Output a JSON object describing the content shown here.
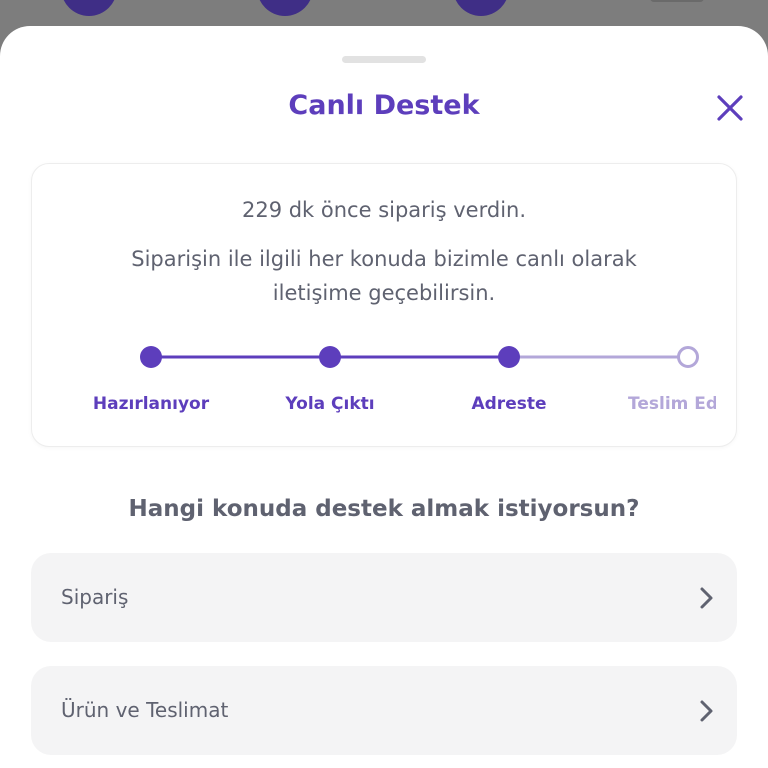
{
  "sheet": {
    "title": "Canlı Destek"
  },
  "order_status": {
    "ordered_text": "229 dk önce sipariş verdin.",
    "info_text": "Siparişin ile ilgili her konuda bizimle canlı olarak iletişime geçebilirsin.",
    "steps": [
      {
        "label": "Hazırlanıyor",
        "completed": true
      },
      {
        "label": "Yola Çıktı",
        "completed": true
      },
      {
        "label": "Adreste",
        "completed": true
      },
      {
        "label": "Teslim Edildi",
        "completed": false
      }
    ]
  },
  "support": {
    "question": "Hangi konuda destek almak istiyorsun?",
    "options": [
      {
        "label": "Sipariş"
      },
      {
        "label": "Ürün ve Teslimat"
      }
    ]
  },
  "colors": {
    "brand": "#5d3ebc",
    "pending": "#b3a7d9",
    "text": "#5f6270"
  },
  "icons": {
    "close": "close-icon",
    "chevron": "chevron-right-icon"
  }
}
